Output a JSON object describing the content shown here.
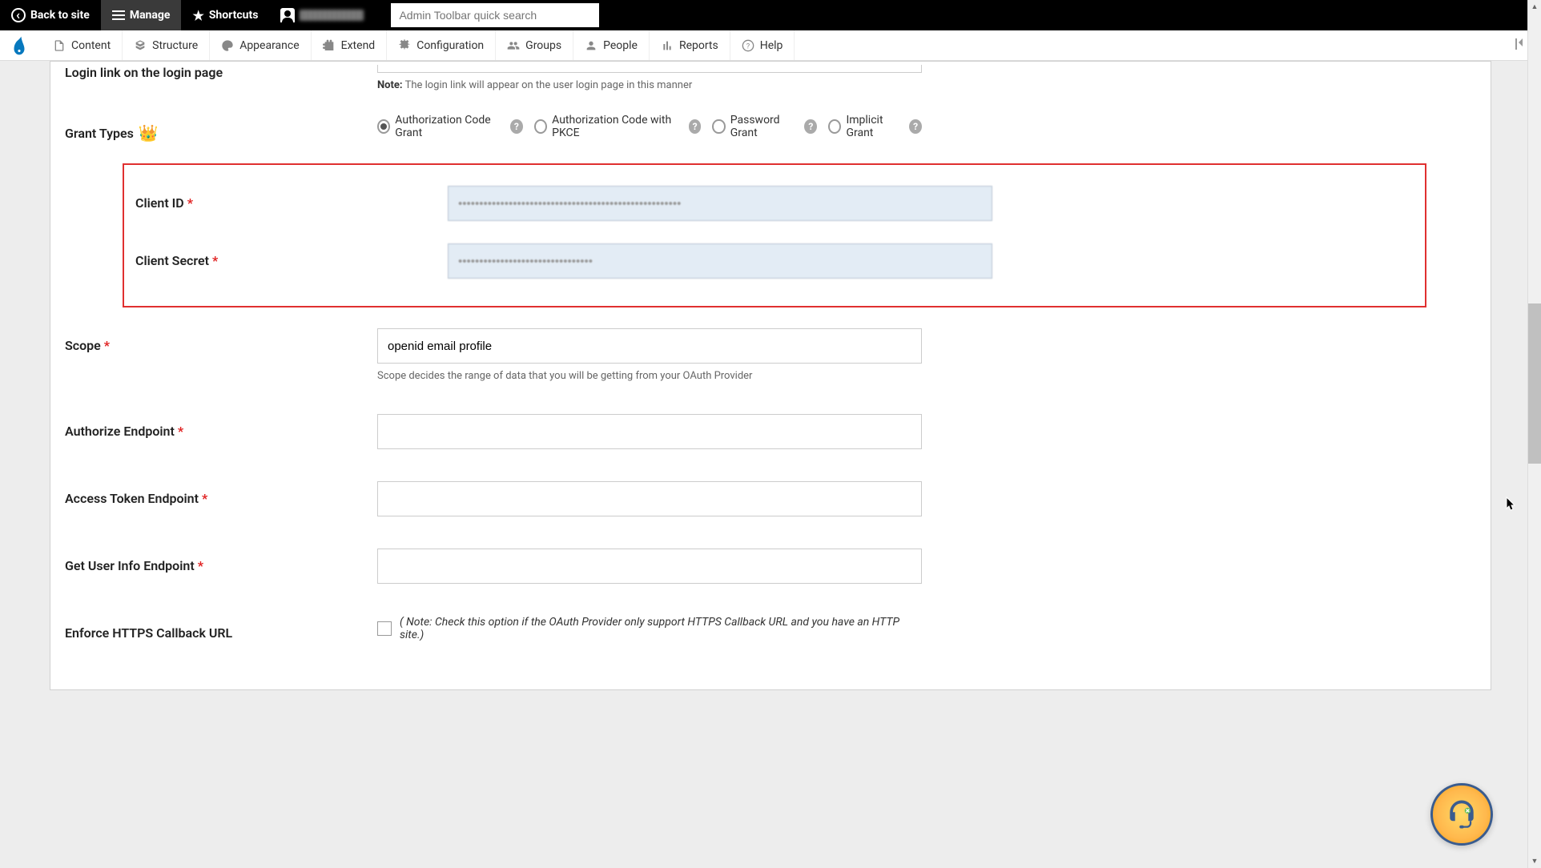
{
  "topToolbar": {
    "backToSite": "Back to site",
    "manage": "Manage",
    "shortcuts": "Shortcuts",
    "searchPlaceholder": "Admin Toolbar quick search"
  },
  "secondaryToolbar": {
    "content": "Content",
    "structure": "Structure",
    "appearance": "Appearance",
    "extend": "Extend",
    "configuration": "Configuration",
    "groups": "Groups",
    "people": "People",
    "reports": "Reports",
    "help": "Help"
  },
  "form": {
    "loginLinkLabel": "Login link on the login page",
    "loginLinkNotePrefix": "Note:",
    "loginLinkNote": " The login link will appear on the user login page in this manner",
    "grantTypesLabel": "Grant Types",
    "grantTypes": [
      {
        "label": "Authorization Code Grant",
        "checked": true
      },
      {
        "label": "Authorization Code with PKCE",
        "checked": false
      },
      {
        "label": "Password Grant",
        "checked": false
      },
      {
        "label": "Implicit Grant",
        "checked": false
      }
    ],
    "helpBadge": "?",
    "clientIdLabel": "Client ID",
    "clientIdValue": "•••••••••••••••••••••••••••••••••••••••••••••••••••••",
    "clientSecretLabel": "Client Secret",
    "clientSecretValue": "••••••••••••••••••••••••••••••••",
    "scopeLabel": "Scope",
    "scopeValue": "openid email profile",
    "scopeHelp": "Scope decides the range of data that you will be getting from your OAuth Provider",
    "authorizeEndpointLabel": "Authorize Endpoint",
    "accessTokenEndpointLabel": "Access Token Endpoint",
    "userInfoEndpointLabel": "Get User Info Endpoint",
    "enforceHttpsLabel": "Enforce HTTPS Callback URL",
    "enforceHttpsNote": "( Note: Check this option if the OAuth Provider only support HTTPS Callback URL and you have an HTTP site.)"
  }
}
